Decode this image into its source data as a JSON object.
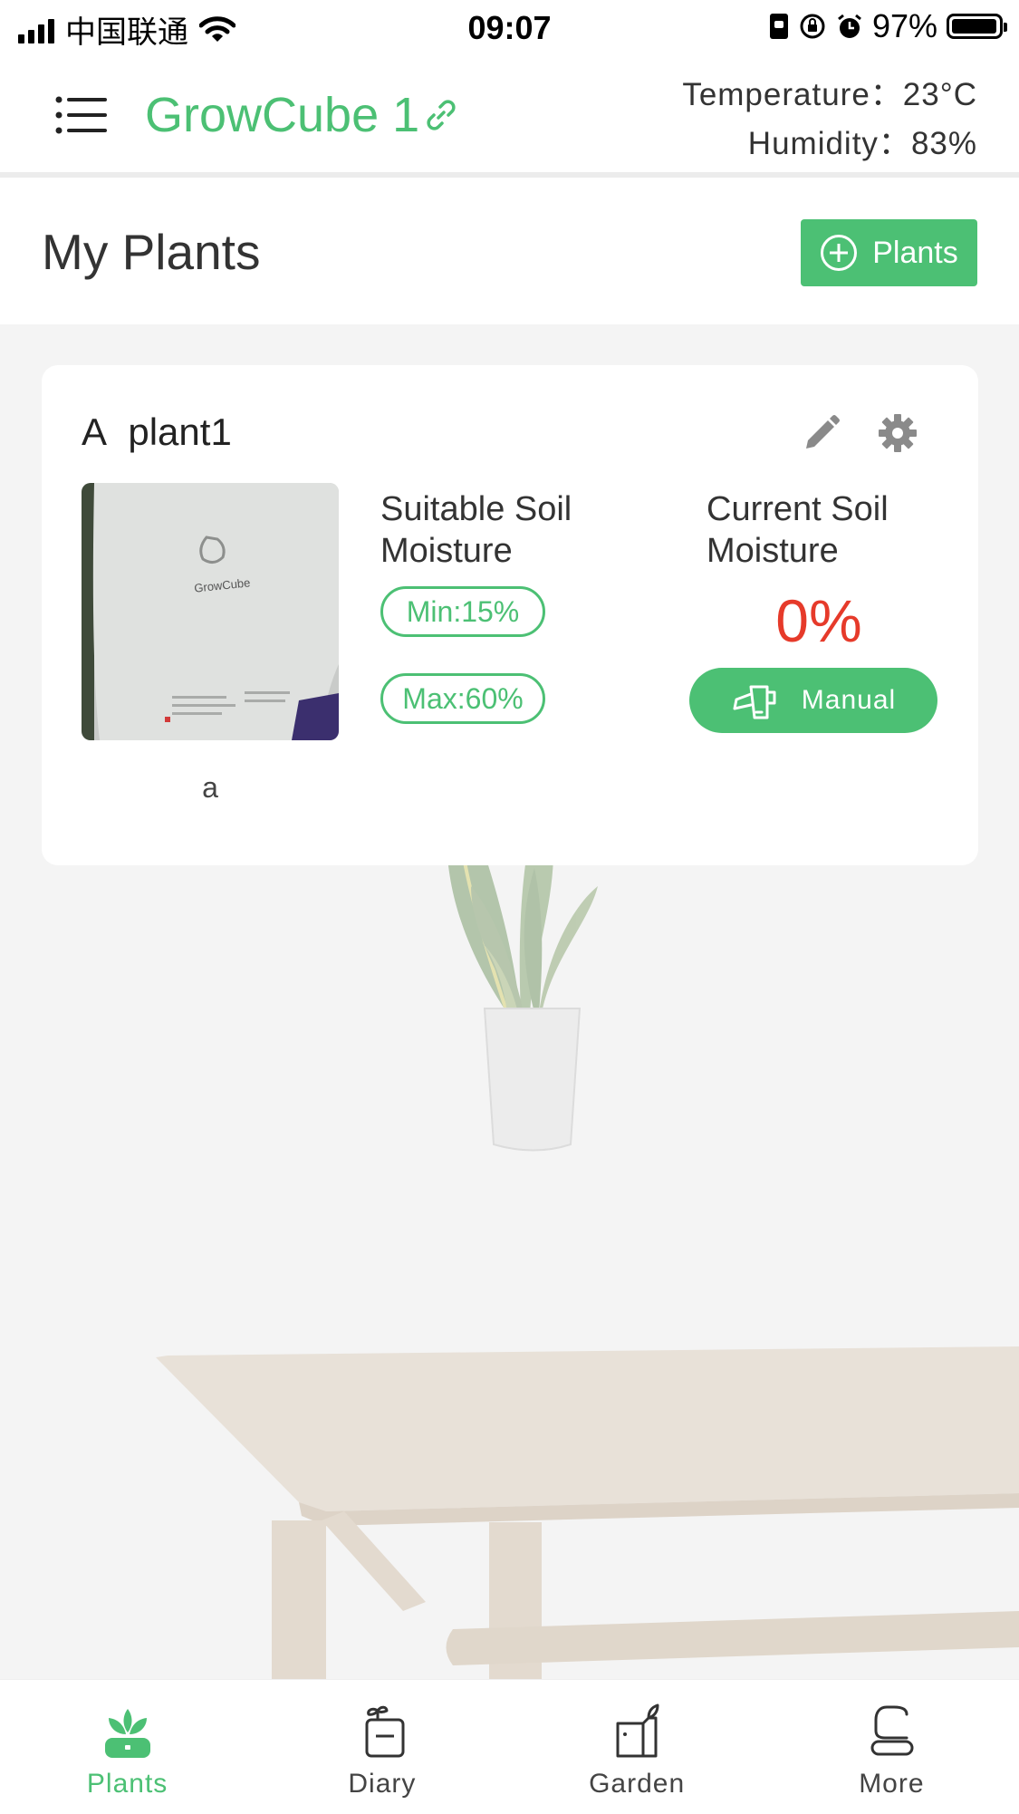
{
  "status_bar": {
    "carrier": "中国联通",
    "time": "09:07",
    "battery": "97%",
    "battery_level": 0.97,
    "icons": [
      "signal-icon",
      "wifi-icon",
      "portrait-lock-icon",
      "rotation-lock-icon",
      "alarm-icon",
      "battery-icon"
    ]
  },
  "header": {
    "title": "GrowCube 1",
    "temperature_label": "Temperature：",
    "temperature_value": "23°C",
    "humidity_label": "Humidity：",
    "humidity_value": "83%",
    "menu_icon": "hamburger-menu-icon",
    "link_icon": "link-icon"
  },
  "section": {
    "title": "My Plants",
    "add_button_label": "Plants",
    "add_icon": "plus-circle-icon"
  },
  "plant_card": {
    "name": "A  plant1",
    "photo_brand_text": "GrowCube",
    "photo_caption": "a",
    "suitable_label": "Suitable Soil Moisture",
    "min_label": "Min:15%",
    "max_label": "Max:60%",
    "current_label": "Current Soil Moisture",
    "current_value": "0%",
    "manual_button_label": "Manual",
    "icons": [
      "edit-icon",
      "gear-icon",
      "watering-can-icon"
    ]
  },
  "tab_bar": {
    "tabs": [
      {
        "label": "Plants",
        "icon": "plants-icon",
        "active": true
      },
      {
        "label": "Diary",
        "icon": "diary-icon",
        "active": false
      },
      {
        "label": "Garden",
        "icon": "garden-icon",
        "active": false
      },
      {
        "label": "More",
        "icon": "more-icon",
        "active": false
      }
    ]
  },
  "colors": {
    "accent": "#4cc074",
    "warning": "#e63a2a",
    "background": "#f4f4f4"
  }
}
